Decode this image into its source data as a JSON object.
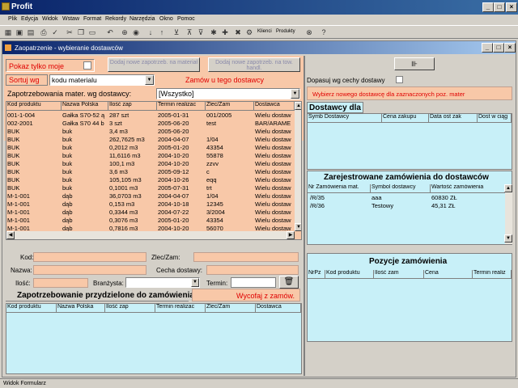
{
  "app": {
    "title": "Profit"
  },
  "menu": [
    "Plik",
    "Edycja",
    "Widok",
    "Wstaw",
    "Format",
    "Rekordy",
    "Narzędzia",
    "Okno",
    "Pomoc"
  ],
  "toolbar": {
    "klienci": "Klienci",
    "produkty": "Produkty"
  },
  "window": {
    "title": "Zaopatrzenie - wybieranie dostawców"
  },
  "left": {
    "pokaz_tylko_moje": "Pokaz tylko moje",
    "dodaj_zapotrz_1": "Dodaj nowe zapotrzeb. na materiał",
    "dodaj_zapotrz_2": "Dodaj nowe zapotrzeb. na tow. handl.",
    "sortuj_label": "Sortuj wg",
    "sortuj_value": "kodu materialu",
    "zamow_link": "Zamów u tego dostawcy",
    "zapotrz_label": "Zapotrzebowania mater. wg dostawcy:",
    "dostawca_value": "[Wszystko]",
    "columns": [
      "Kod produktu",
      "Nazwa Polska",
      "Ilość zap",
      "Termin realizac",
      "Zlec/Zam",
      "Dostawca"
    ],
    "rows": [
      [
        "001-1-004",
        "Gałka S70-52 ą",
        "287 szt",
        "2005-01-31",
        "001/2005",
        "Wielu dostaw"
      ],
      [
        "002-2001",
        "Gałka S70 44 b",
        "3 szt",
        "2005-06-20",
        "test",
        "BAR/ARAME"
      ],
      [
        "BUK",
        "buk",
        "3,4 m3",
        "2005-06-20",
        "",
        "Wielu dostaw"
      ],
      [
        "BUK",
        "buk",
        "262,7625 m3",
        "2004-04-07",
        "1/04",
        "Wielu dostaw"
      ],
      [
        "BUK",
        "buk",
        "0,2012 m3",
        "2005-01-20",
        "43354",
        "Wielu dostaw"
      ],
      [
        "BUK",
        "buk",
        "11,6116 m3",
        "2004-10-20",
        "55878",
        "Wielu dostaw"
      ],
      [
        "BUK",
        "buk",
        "100,1 m3",
        "2004-10-20",
        "zzvv",
        "Wielu dostaw"
      ],
      [
        "BUK",
        "buk",
        "3,6 m3",
        "2005-09-12",
        "c",
        "Wielu dostaw"
      ],
      [
        "BUK",
        "buk",
        "105,105 m3",
        "2004-10-26",
        "eqq",
        "Wielu dostaw"
      ],
      [
        "BUK",
        "buk",
        "0,1001 m3",
        "2005-07-31",
        "trt",
        "Wielu dostaw"
      ],
      [
        "M-1-001",
        "dąb",
        "36,0703 m3",
        "2004-04-07",
        "1/04",
        "Wielu dostaw"
      ],
      [
        "M-1-001",
        "dąb",
        "0,153 m3",
        "2004-10-18",
        "12345",
        "Wielu dostaw"
      ],
      [
        "M-1-001",
        "dąb",
        "0,3344 m3",
        "2004-07-22",
        "3/2004",
        "Wielu dostaw"
      ],
      [
        "M-1-001",
        "dąb",
        "0,3076 m3",
        "2005-01-20",
        "43354",
        "Wielu dostaw"
      ],
      [
        "M-1-001",
        "dąb",
        "0,7816 m3",
        "2004-10-20",
        "56070",
        "Wielu dostaw"
      ]
    ],
    "kod_label": "Kod:",
    "zlec_label": "Zlec/Zam:",
    "nazwa_label": "Nazwa:",
    "cecha_label": "Cecha dostawy:",
    "ilosc_label": "Ilość:",
    "branzysta_label": "Branżysta:",
    "termin_label": "Termin:",
    "przydzielone_title": "Zapotrzebowanie przydzielone do zamówienia",
    "wycofaj": "Wycofaj z zamów.",
    "przydzielone_columns": [
      "Kod produktu",
      "Nazwa Polska",
      "Ilość zap",
      "Termin realizac",
      "Zlec/Zam",
      "Dostawca"
    ]
  },
  "right": {
    "dopasuj_label": "Dopasuj wg cechy dostawy",
    "wybierz_btn": "Wybierz nowego dostawcę dla zaznaczonych poz. mater",
    "dostawcy_dla": "Dostawcy dla",
    "dostawcy_columns": [
      "Symb Dostawcy",
      "Cena zakupu",
      "Data ost zak",
      "Dost w ciąg"
    ],
    "zamowienia_title": "Zarejestrowane zamówienia do dostawców",
    "zamowienia_columns": [
      "Nr Zamówienia mat.",
      "Symbol dostawcy",
      "Wartość zamówienia"
    ],
    "zamowienia_rows": [
      [
        "/R/35",
        "aaa",
        "60830 ZŁ"
      ],
      [
        "/R/36",
        "Testowy",
        "45,31 ZŁ"
      ]
    ],
    "pozycje_title": "Pozycje zamówienia",
    "pozycje_columns": [
      "NrPz",
      "Kod produktu",
      "Ilość zam",
      "Cena",
      "Termin realiz"
    ]
  },
  "status": {
    "text": "Widok Formularz"
  }
}
